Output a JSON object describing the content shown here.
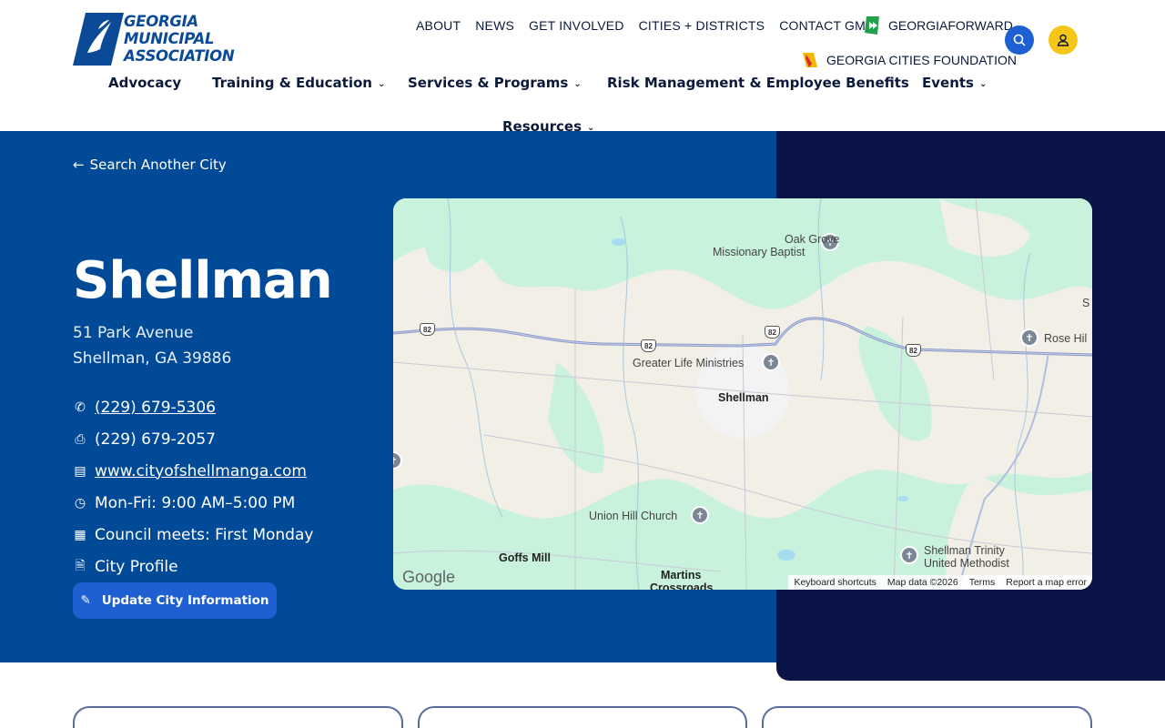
{
  "logo": {
    "line1": "GEORGIA",
    "line2": "MUNICIPAL",
    "line3": "ASSOCIATION"
  },
  "topnav": [
    "ABOUT",
    "NEWS",
    "GET INVOLVED",
    "CITIES + DISTRICTS",
    "CONTACT GMA"
  ],
  "georgiaforward": "GEORGIAFORWARD",
  "gcf": "GEORGIA CITIES FOUNDATION",
  "mainnav": {
    "advocacy": "Advocacy",
    "training": "Training & Education",
    "services": "Services & Programs",
    "risk": "Risk Management & Employee Benefits",
    "events": "Events",
    "resources": "Resources"
  },
  "back_link": "Search Another City",
  "city": {
    "name": "Shellman",
    "address1": "51 Park Avenue",
    "address2": "Shellman, GA 39886",
    "phone": "(229) 679-5306",
    "fax": "(229) 679-2057",
    "website": "www.cityofshellmanga.com",
    "hours": "Mon-Fri: 9:00 AM–5:00 PM",
    "council": "Council meets: First Monday",
    "profile": "City Profile"
  },
  "update_button": "Update City Information",
  "map": {
    "labels": {
      "oak_grove_1": "Oak Grove",
      "oak_grove_2": "Missionary Baptist",
      "greater_life": "Greater Life Ministries",
      "shellman": "Shellman",
      "rose_hill": "Rose Hil",
      "union_hill": "Union Hill Church",
      "goffs_mill": "Goffs Mill",
      "martins_1": "Martins",
      "martins_2": "Crossroads",
      "trinity_1": "Shellman Trinity",
      "trinity_2": "United Methodist",
      "edge_s": "S"
    },
    "route": "82",
    "google": "Google",
    "attribution": [
      "Keyboard shortcuts",
      "Map data ©2026",
      "Terms",
      "Report a map error"
    ]
  },
  "colors": {
    "brand_blue": "#004a97",
    "dark_navy": "#0b1447",
    "button_blue": "#1e5fd2",
    "user_yellow": "#f5c518"
  }
}
